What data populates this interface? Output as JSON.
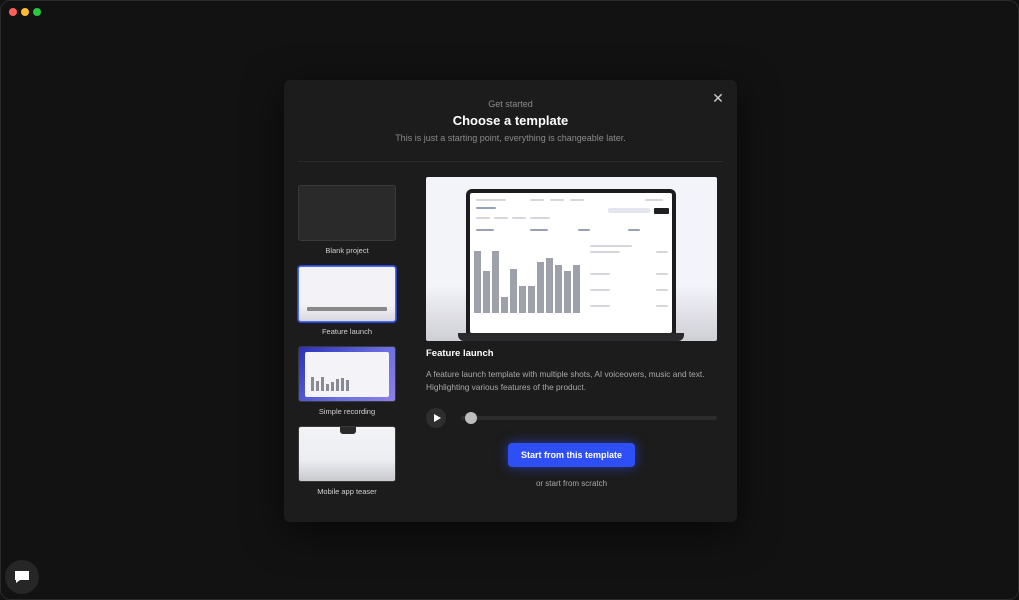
{
  "modal": {
    "eyebrow": "Get started",
    "title": "Choose a template",
    "subtitle": "This is just a starting point, everything is changeable later."
  },
  "templates": [
    {
      "label": "Blank project",
      "selected": false
    },
    {
      "label": "Feature launch",
      "selected": true
    },
    {
      "label": "Simple recording",
      "selected": false
    },
    {
      "label": "Mobile app teaser",
      "selected": false
    }
  ],
  "detail": {
    "title": "Feature launch",
    "description": "A feature launch template with multiple shots, AI voiceovers, music and text. Highlighting various features of the product.",
    "playback_progress": 0.02
  },
  "actions": {
    "start_template": "Start from this template",
    "start_scratch": "or start from scratch"
  },
  "icons": {
    "close": "close-icon",
    "play": "play-icon",
    "chat": "chat-icon"
  },
  "colors": {
    "accent": "#2e4ff5",
    "modal_bg": "#1c1c1c",
    "page_bg": "#121212"
  }
}
